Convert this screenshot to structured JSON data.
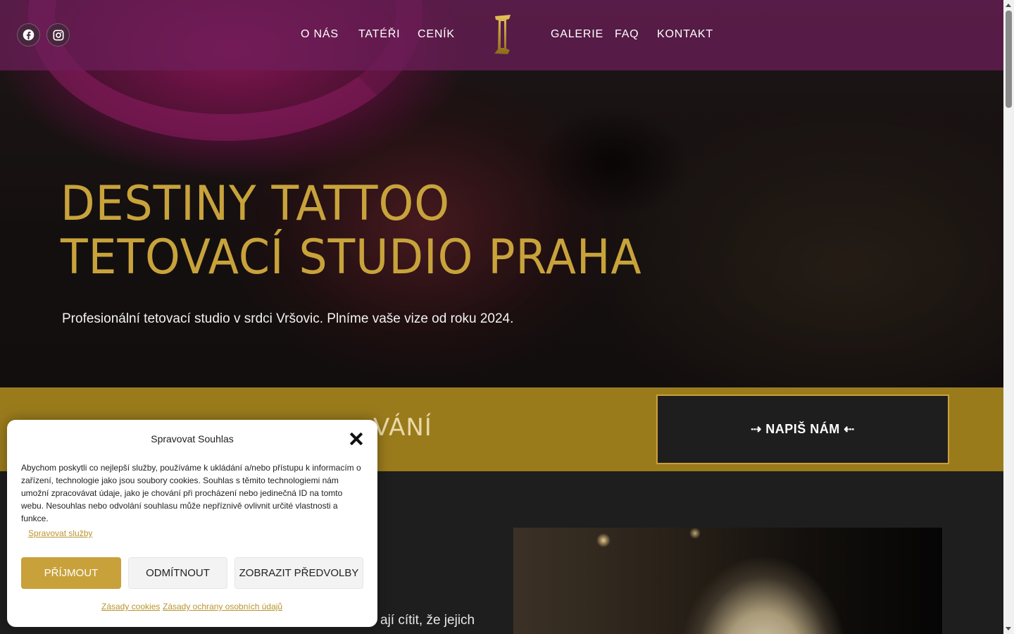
{
  "header": {
    "social": [
      {
        "name": "facebook",
        "icon": "facebook-icon"
      },
      {
        "name": "instagram",
        "icon": "instagram-icon"
      }
    ],
    "nav_left": [
      "O NÁS",
      "TATÉŘI",
      "CENÍK"
    ],
    "nav_right": [
      "GALERIE",
      "FAQ",
      "KONTAKT"
    ],
    "logo_icon": "destiny-logo-icon"
  },
  "hero": {
    "title_line1": "DESTINY TATTOO",
    "title_line2": "TETOVACÍ STUDIO PRAHA",
    "subtitle": "Profesionální tetovací studio v srdci Vršovic. Plníme vaše vize od roku 2024."
  },
  "band": {
    "partial_heading": "VÁNÍ",
    "cta_label": "⇢ NAPIŠ NÁM ⇠"
  },
  "lower": {
    "partial_text": "ají cítit, že jejich"
  },
  "cookie_modal": {
    "title": "Spravovat Souhlas",
    "body": "Abychom poskytli co nejlepší služby, používáme k ukládání a/nebo přístupu k informacím o zařízení, technologie jako jsou soubory cookies. Souhlas s těmito technologiemi nám umožní zpracovávat údaje, jako je chování při procházení nebo jedinečná ID na tomto webu. Nesouhlas nebo odvolání souhlasu může nepříznivě ovlivnit určité vlastnosti a funkce.",
    "manage_services": "Spravovat služby",
    "accept": "PŘÍJMOUT",
    "deny": "ODMÍTNOUT",
    "preferences": "ZOBRAZIT PŘEDVOLBY",
    "cookie_policy": "Zásady cookies",
    "privacy_policy": "Zásady ochrany osobních údajů"
  },
  "colors": {
    "gold": "#c9a13a",
    "band_gold": "#9a7b1c",
    "header_purple": "#6e1e5a",
    "dark": "#1e1e1e"
  }
}
